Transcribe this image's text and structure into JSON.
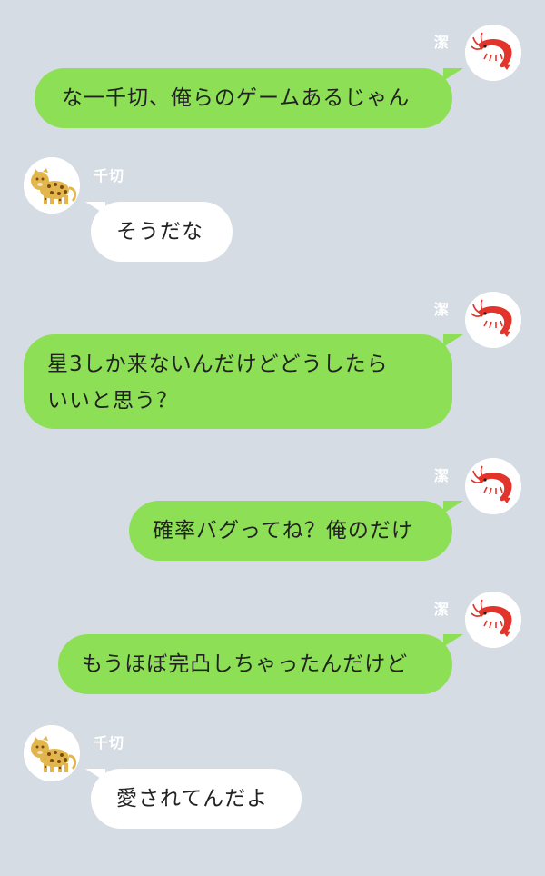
{
  "contacts": {
    "me": {
      "name": "潔",
      "avatar_icon": "shrimp-icon"
    },
    "other": {
      "name": "千切",
      "avatar_icon": "leopard-icon"
    }
  },
  "messages": [
    {
      "sender": "潔",
      "lines": [
        "な一千切、俺らのゲームあるじゃん"
      ]
    },
    {
      "sender": "千切",
      "lines": [
        "そうだな"
      ]
    },
    {
      "sender": "潔",
      "lines": [
        "星3しか来ないんだけどどうしたら",
        "いいと思う？"
      ]
    },
    {
      "sender": "潔",
      "lines": [
        "確率バグってね？俺のだけ"
      ]
    },
    {
      "sender": "潔",
      "lines": [
        "もうほぼ完凸しちゃったんだけど"
      ]
    },
    {
      "sender": "千切",
      "lines": [
        "愛されてんだよ"
      ]
    }
  ],
  "colors": {
    "background": "#d5dce4",
    "outgoing_bubble": "#8de055",
    "incoming_bubble": "#ffffff",
    "name_text": "#ffffff"
  }
}
